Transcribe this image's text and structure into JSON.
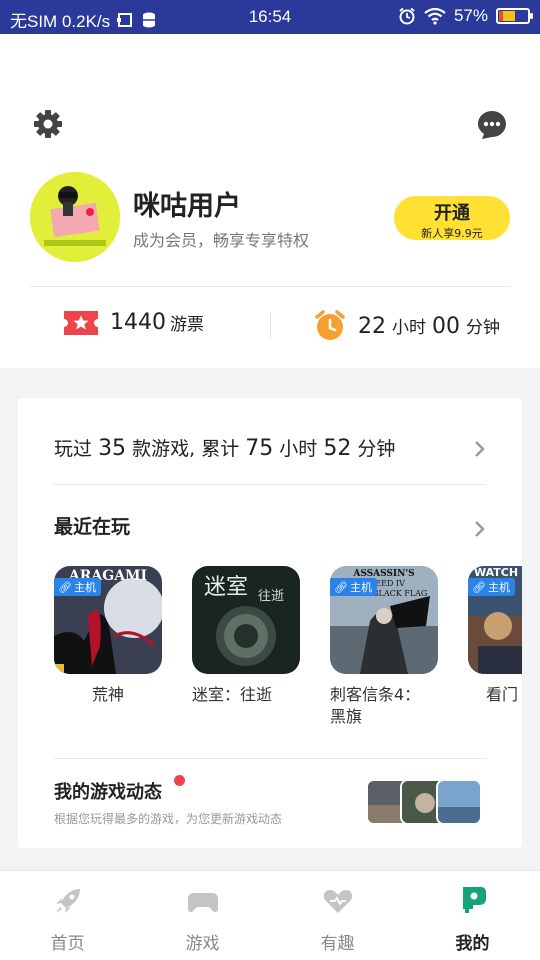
{
  "status_bar": {
    "left_text": "无SIM 0.2K/s",
    "time": "16:54",
    "battery": "57%",
    "battery_level": 0.57
  },
  "header": {
    "settings_icon": "gear-icon",
    "message_icon": "message-icon"
  },
  "profile": {
    "username": "咪咕用户",
    "subtitle": "成为会员，畅享专享特权",
    "vip_button_label": "开通",
    "vip_button_sub": "新人享9.9元"
  },
  "stats": {
    "tickets_value": "1440",
    "tickets_unit": "游票",
    "time_hours": "22",
    "time_hours_unit": "小时",
    "time_minutes": "00",
    "time_minutes_unit": "分钟"
  },
  "played_summary": {
    "prefix": "玩过",
    "games_count": "35",
    "mid": "款游戏, 累计",
    "hours": "75",
    "hours_unit": "小时",
    "minutes": "52",
    "minutes_unit": "分钟"
  },
  "recent": {
    "title": "最近在玩",
    "games": [
      {
        "name": "荒神",
        "badge": "主机"
      },
      {
        "name": "迷室：往逝",
        "badge": ""
      },
      {
        "name": "刺客信条4：黑旗",
        "badge": "主机"
      },
      {
        "name": "看门",
        "badge": "主机"
      }
    ],
    "thumb_titles": {
      "aragami": "ARAGAMI",
      "room": "迷室",
      "room_sub": "往逝",
      "ac_line1": "ASSASSIN'S",
      "ac_line2": "CREED IV",
      "ac_line3": "BLACK FLAG",
      "wd": "WATCH"
    }
  },
  "dynamics": {
    "title": "我的游戏动态",
    "subtitle": "根据您玩得最多的游戏，为您更新游戏动态"
  },
  "nav": {
    "items": [
      {
        "label": "首页",
        "icon": "rocket-icon",
        "active": false
      },
      {
        "label": "游戏",
        "icon": "gamepad-icon",
        "active": false
      },
      {
        "label": "有趣",
        "icon": "heart-icon",
        "active": false
      },
      {
        "label": "我的",
        "icon": "profile-icon",
        "active": true
      }
    ]
  },
  "colors": {
    "status_bar": "#2b3a9a",
    "vip_yellow": "#ffe033",
    "ticket_red": "#f0444c",
    "clock_orange": "#f5a030",
    "nav_active": "#16a27a",
    "badge_blue": "#2a84e8"
  }
}
